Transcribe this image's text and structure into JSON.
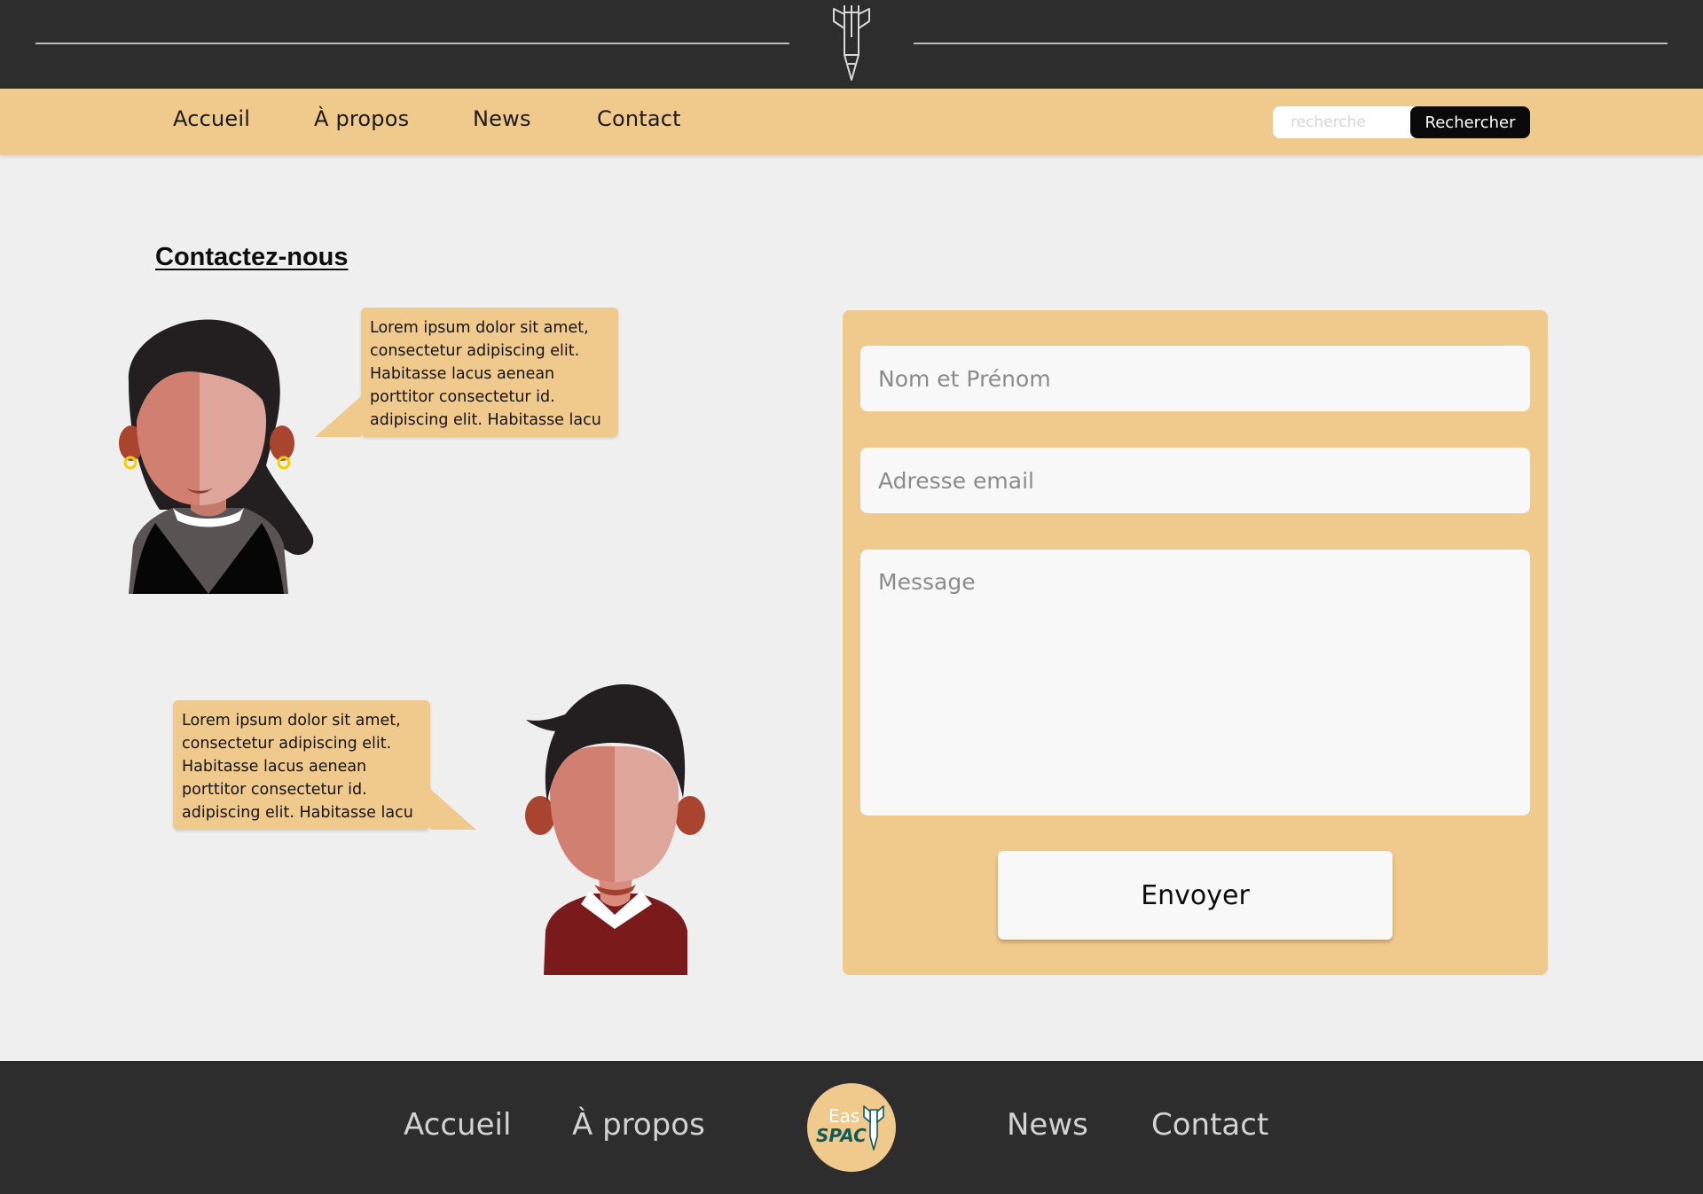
{
  "nav": {
    "items": [
      "Accueil",
      "À propos",
      "News",
      "Contact"
    ]
  },
  "search": {
    "placeholder": "recherche",
    "button_label": "Rechercher"
  },
  "main": {
    "title": "Contactez-nous",
    "bubbles": [
      "Lorem ipsum dolor sit amet,\nconsectetur adipiscing elit.\nHabitasse lacus aenean\nporttitor consectetur id.\nadipiscing elit. Habitasse lacu",
      "Lorem ipsum dolor sit amet,\nconsectetur adipiscing elit.\nHabitasse lacus aenean\nporttitor consectetur id.\nadipiscing elit. Habitasse lacu"
    ]
  },
  "form": {
    "name_placeholder": "Nom et Prénom",
    "email_placeholder": "Adresse email",
    "message_placeholder": "Message",
    "submit_label": "Envoyer"
  },
  "footer": {
    "items": [
      "Accueil",
      "À propos",
      "News",
      "Contact"
    ],
    "logo_top": "Eas",
    "logo_bottom": "SPAC"
  },
  "icons": {
    "header_logo": "rocket-pen-icon",
    "footer_logo": "easyspace-logo-icon"
  },
  "colors": {
    "dark": "#2d2d2d",
    "accent": "#f0c98c",
    "field": "#f8f8f8",
    "background": "#f0efef"
  }
}
